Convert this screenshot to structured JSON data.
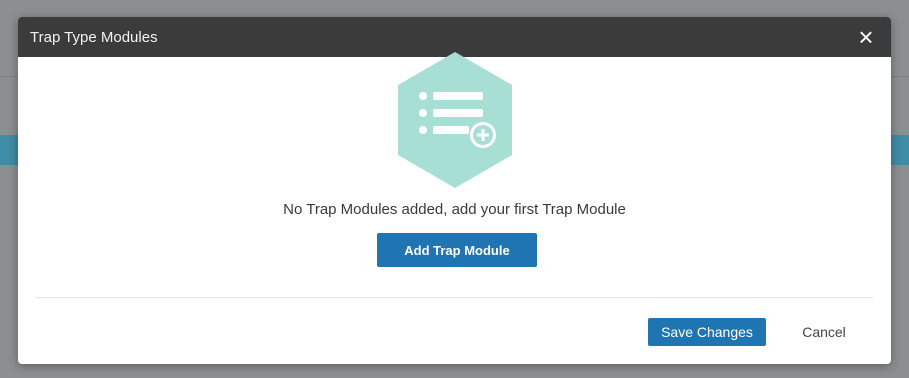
{
  "dialog": {
    "title": "Trap Type Modules",
    "close_icon": "close-icon"
  },
  "empty_state": {
    "icon": "list-add-icon",
    "icon_color": "#a8dfd4",
    "message": "No Trap Modules added, add your first Trap Module",
    "add_button_label": "Add Trap Module"
  },
  "footer": {
    "save_label": "Save Changes",
    "cancel_label": "Cancel"
  },
  "colors": {
    "header_bg": "#3b3b3b",
    "primary": "#1f75b2",
    "backdrop": "#8c8f91"
  }
}
